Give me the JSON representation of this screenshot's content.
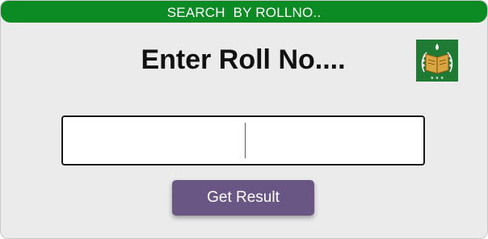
{
  "header": {
    "title": "SEARCH  BY ROLLNO.."
  },
  "main": {
    "heading": "Enter Roll No....",
    "roll_input": {
      "value": "",
      "placeholder": ""
    },
    "submit_label": "Get Result"
  },
  "logo": {
    "icon": "book-torch-emblem-icon"
  },
  "colors": {
    "header_bg": "#0c8a23",
    "button_bg": "#6a5685",
    "panel_bg": "#ebebeb",
    "logo_bg": "#1f7a34"
  }
}
